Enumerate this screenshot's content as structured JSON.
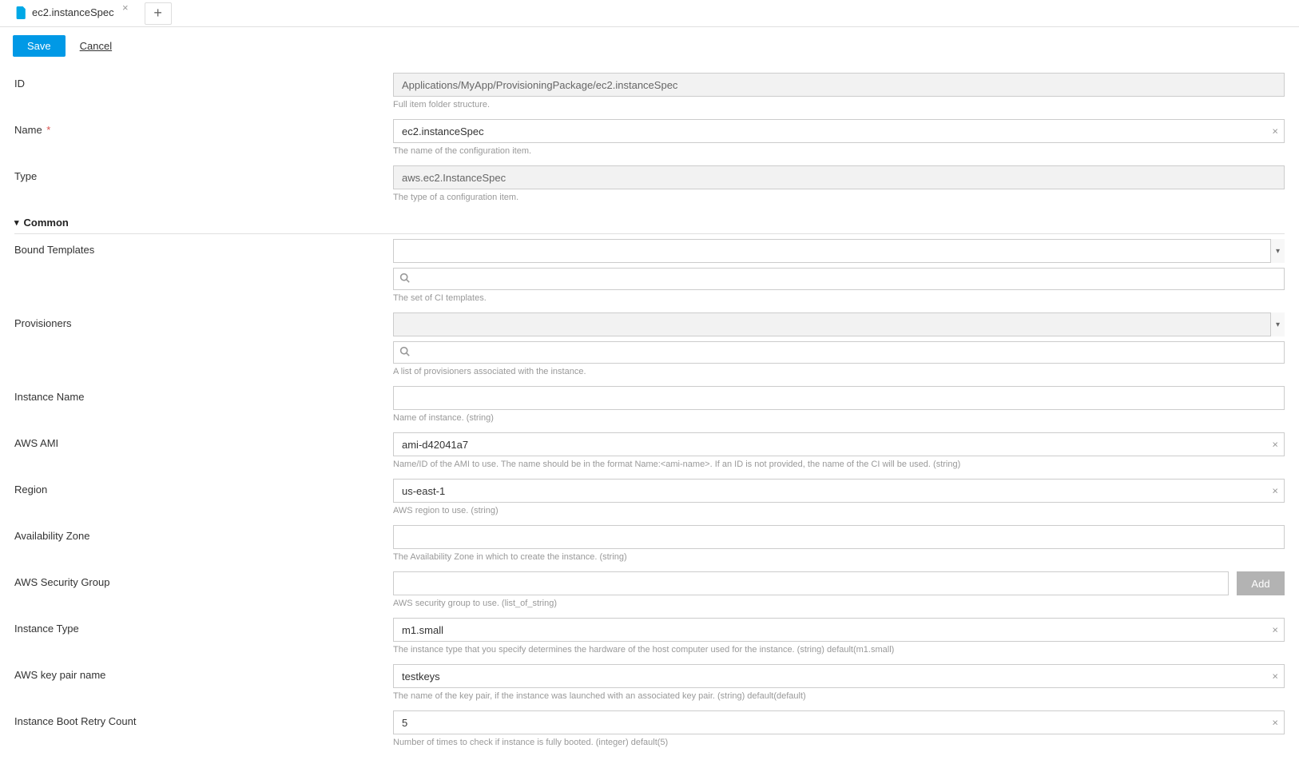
{
  "tabs": {
    "active_label": "ec2.instanceSpec",
    "close_glyph": "×",
    "add_glyph": "+"
  },
  "actions": {
    "save": "Save",
    "cancel": "Cancel"
  },
  "section": {
    "common": "Common"
  },
  "fields": {
    "id": {
      "label": "ID",
      "value": "Applications/MyApp/ProvisioningPackage/ec2.instanceSpec",
      "help": "Full item folder structure."
    },
    "name": {
      "label": "Name",
      "value": "ec2.instanceSpec",
      "help": "The name of the configuration item."
    },
    "type": {
      "label": "Type",
      "value": "aws.ec2.InstanceSpec",
      "help": "The type of a configuration item."
    },
    "bound_templates": {
      "label": "Bound Templates",
      "help": "The set of CI templates."
    },
    "provisioners": {
      "label": "Provisioners",
      "help": "A list of provisioners associated with the instance."
    },
    "instance_name": {
      "label": "Instance Name",
      "value": "",
      "help": "Name of instance. (string)"
    },
    "aws_ami": {
      "label": "AWS AMI",
      "value": "ami-d42041a7",
      "help": "Name/ID of the AMI to use. The name should be in the format Name:<ami-name>. If an ID is not provided, the name of the CI will be used. (string)"
    },
    "region": {
      "label": "Region",
      "value": "us-east-1",
      "help": "AWS region to use. (string)"
    },
    "availability_zone": {
      "label": "Availability Zone",
      "value": "",
      "help": "The Availability Zone in which to create the instance. (string)"
    },
    "security_group": {
      "label": "AWS Security Group",
      "value": "",
      "help": "AWS security group to use. (list_of_string)",
      "add_btn": "Add"
    },
    "instance_type": {
      "label": "Instance Type",
      "value": "m1.small",
      "help": "The instance type that you specify determines the hardware of the host computer used for the instance. (string) default(m1.small)"
    },
    "key_pair": {
      "label": "AWS key pair name",
      "value": "testkeys",
      "help": "The name of the key pair, if the instance was launched with an associated key pair. (string) default(default)"
    },
    "boot_retry": {
      "label": "Instance Boot Retry Count",
      "value": "5",
      "help": "Number of times to check if instance is fully booted. (integer) default(5)"
    }
  },
  "glyphs": {
    "clear": "×",
    "caret": "▾",
    "chevron_down": "▾"
  }
}
